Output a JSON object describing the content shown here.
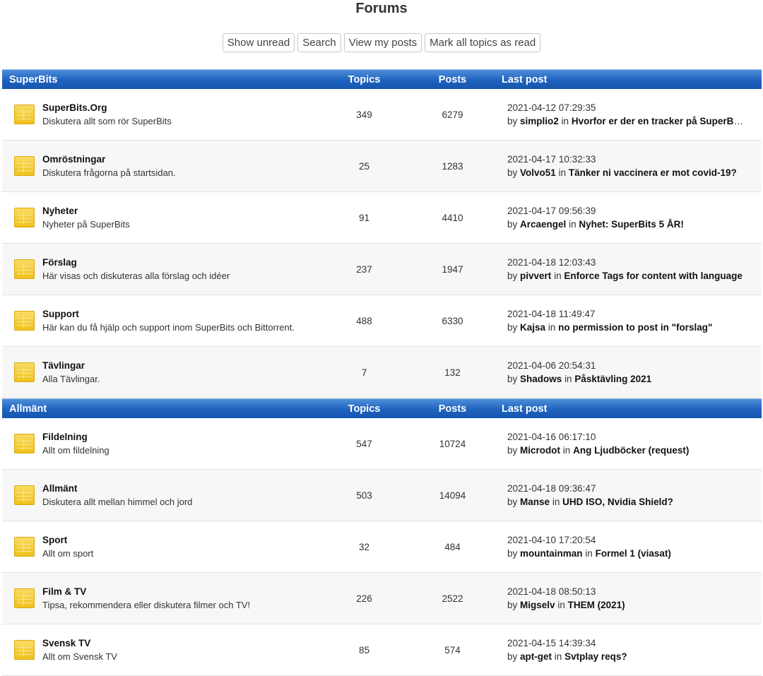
{
  "title": "Forums",
  "toolbar": {
    "show_unread": "Show unread",
    "search": "Search",
    "view_my_posts": "View my posts",
    "mark_all_read": "Mark all topics as read"
  },
  "columns": {
    "topics": "Topics",
    "posts": "Posts",
    "last_post": "Last post"
  },
  "by_label": "by",
  "in_label": "in",
  "sections": [
    {
      "name": "SuperBits",
      "forums": [
        {
          "title": "SuperBits.Org",
          "desc": "Diskutera allt som rör SuperBits",
          "topics": "349",
          "posts": "6279",
          "date": "2021-04-12 07:29:35",
          "user": "simplio2",
          "topic": "Hvorfor er der en tracker på SuperBits?"
        },
        {
          "title": "Omröstningar",
          "desc": "Diskutera frågorna på startsidan.",
          "topics": "25",
          "posts": "1283",
          "date": "2021-04-17 10:32:33",
          "user": "Volvo51",
          "topic": "Tänker ni vaccinera er mot covid-19?"
        },
        {
          "title": "Nyheter",
          "desc": "Nyheter på SuperBits",
          "topics": "91",
          "posts": "4410",
          "date": "2021-04-17 09:56:39",
          "user": "Arcaengel",
          "topic": "Nyhet: SuperBits 5 ÅR!"
        },
        {
          "title": "Förslag",
          "desc": "Här visas och diskuteras alla förslag och idéer",
          "topics": "237",
          "posts": "1947",
          "date": "2021-04-18 12:03:43",
          "user": "pivvert",
          "topic": "Enforce Tags for content with language"
        },
        {
          "title": "Support",
          "desc": "Här kan du få hjälp och support inom SuperBits och Bittorrent.",
          "topics": "488",
          "posts": "6330",
          "date": "2021-04-18 11:49:47",
          "user": "Kajsa",
          "topic": "no permission to post in \"forslag\""
        },
        {
          "title": "Tävlingar",
          "desc": "Alla Tävlingar.",
          "topics": "7",
          "posts": "132",
          "date": "2021-04-06 20:54:31",
          "user": "Shadows",
          "topic": "Påsktävling 2021"
        }
      ]
    },
    {
      "name": "Allmänt",
      "forums": [
        {
          "title": "Fildelning",
          "desc": "Allt om fildelning",
          "topics": "547",
          "posts": "10724",
          "date": "2021-04-16 06:17:10",
          "user": "Microdot",
          "topic": "Ang Ljudböcker (request)"
        },
        {
          "title": "Allmänt",
          "desc": "Diskutera allt mellan himmel och jord",
          "topics": "503",
          "posts": "14094",
          "date": "2021-04-18 09:36:47",
          "user": "Manse",
          "topic": "UHD ISO, Nvidia Shield?"
        },
        {
          "title": "Sport",
          "desc": "Allt om sport",
          "topics": "32",
          "posts": "484",
          "date": "2021-04-10 17:20:54",
          "user": "mountainman",
          "topic": "Formel 1 (viasat)"
        },
        {
          "title": "Film & TV",
          "desc": "Tipsa, rekommendera eller diskutera filmer och TV!",
          "topics": "226",
          "posts": "2522",
          "date": "2021-04-18 08:50:13",
          "user": "Migselv",
          "topic": "THEM (2021)"
        },
        {
          "title": "Svensk TV",
          "desc": "Allt om Svensk TV",
          "topics": "85",
          "posts": "574",
          "date": "2021-04-15 14:39:34",
          "user": "apt-get",
          "topic": "Svtplay reqs?"
        }
      ]
    }
  ]
}
